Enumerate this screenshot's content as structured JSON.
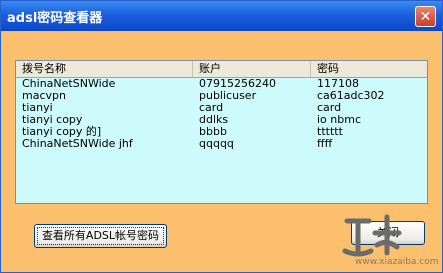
{
  "window": {
    "title": "adsl密码查看器"
  },
  "table": {
    "headers": [
      "拨号名称",
      "账户",
      "密码"
    ],
    "rows": [
      [
        "ChinaNetSNWide",
        "07915256240",
        "117108"
      ],
      [
        "macvpn",
        "publicuser",
        "ca61adc302"
      ],
      [
        "tianyi",
        "card",
        "card"
      ],
      [
        "tianyi copy",
        "ddlks",
        "io nbmc"
      ],
      [
        "tianyi copy 的]",
        "bbbb",
        "tttttt"
      ],
      [
        "ChinaNetSNWide jhf",
        "qqqqq",
        "ffff"
      ]
    ]
  },
  "buttons": {
    "view_all": "查看所有ADSL帐号密码",
    "close": "关闭"
  },
  "watermark": {
    "text": "www.xiazaiba.com",
    "icon": "watermark-logo"
  },
  "icons": {
    "close": "close-icon"
  }
}
